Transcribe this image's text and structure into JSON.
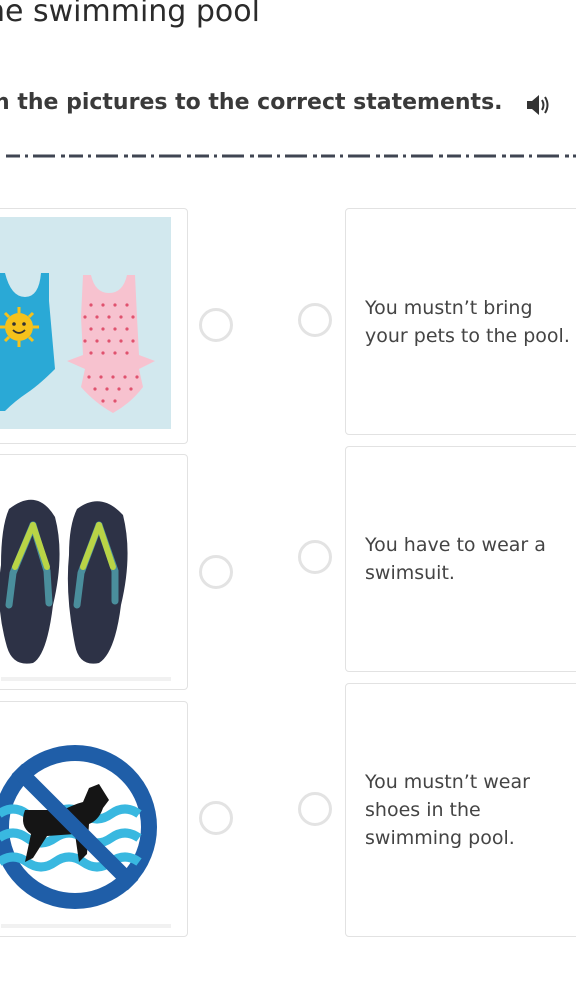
{
  "page": {
    "title": "he swimming pool",
    "instruction": "h the pictures to the correct statements."
  },
  "icons": {
    "audio": "speaker-icon"
  },
  "pictures": [
    {
      "name": "swimsuits",
      "colors": {
        "background": "#d2e8ee",
        "suit_left": "#2aa9d6",
        "suit_right": "#f7c2cf",
        "dots": "#e0526e",
        "sun": "#f6c21b"
      }
    },
    {
      "name": "flip-flops",
      "colors": {
        "sole": "#2d3246",
        "strap": "#b9d446",
        "strap_shadow": "#4a8e9c"
      }
    },
    {
      "name": "no-dogs-sign",
      "colors": {
        "ring": "#1f5ea8",
        "water": "#39b8e0",
        "dog": "#151515"
      }
    }
  ],
  "statements": [
    {
      "text": "You mustn’t bring your pets to the pool."
    },
    {
      "text": "You have to wear a swimsuit."
    },
    {
      "text": "You mustn’t wear shoes in the swimming pool."
    }
  ],
  "colors": {
    "divider": "#3f4552",
    "radio_border": "#e3e3e3",
    "card_border": "#e2e2e2"
  }
}
